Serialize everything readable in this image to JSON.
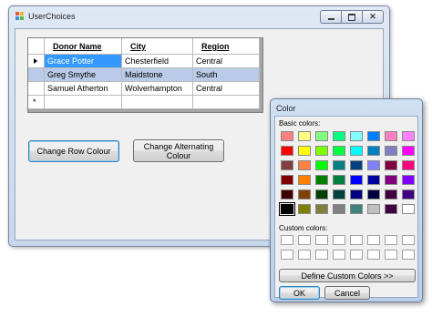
{
  "window": {
    "title": "UserChoices"
  },
  "grid": {
    "headers": [
      "Donor Name",
      "City",
      "Region"
    ],
    "rows": [
      [
        "Grace Potter",
        "Chesterfield",
        "Central"
      ],
      [
        "Greg Smythe",
        "Maidstone",
        "South"
      ],
      [
        "Samuel Atherton",
        "Wolverhampton",
        "Central"
      ]
    ],
    "new_row_marker": "*"
  },
  "buttons": {
    "change_row": "Change Row Colour",
    "change_alt_line1": "Change Alternating",
    "change_alt_line2": "Colour"
  },
  "color_dialog": {
    "title": "Color",
    "basic_label": "Basic colors:",
    "custom_label": "Custom colors:",
    "define_label": "Define Custom Colors >>",
    "ok_label": "OK",
    "cancel_label": "Cancel",
    "basic_colors": [
      [
        "#ff8080",
        "#ffff80",
        "#80ff80",
        "#00ff80",
        "#80ffff",
        "#0080ff",
        "#ff80c0",
        "#ff80ff"
      ],
      [
        "#ff0000",
        "#ffff00",
        "#80ff00",
        "#00ff40",
        "#00ffff",
        "#0080c0",
        "#8080c0",
        "#ff00ff"
      ],
      [
        "#804040",
        "#ff8040",
        "#00ff00",
        "#008080",
        "#004080",
        "#8080ff",
        "#800040",
        "#ff0080"
      ],
      [
        "#800000",
        "#ff8000",
        "#008000",
        "#008040",
        "#0000ff",
        "#0000a0",
        "#800080",
        "#8000ff"
      ],
      [
        "#400000",
        "#804000",
        "#004000",
        "#004040",
        "#000080",
        "#000040",
        "#400040",
        "#400080"
      ],
      [
        "#000000",
        "#808000",
        "#808040",
        "#808080",
        "#408080",
        "#c0c0c0",
        "#400040",
        "#ffffff"
      ]
    ],
    "selected_color": "#000000"
  }
}
